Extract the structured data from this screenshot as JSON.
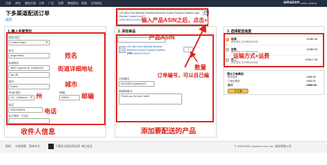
{
  "topbar": {
    "brand": "amazon",
    "brand_sub": "seller central",
    "nav_items": [
      "目录",
      "库存",
      "确定价格",
      "订单",
      "广告",
      "品牌",
      "数据报告",
      "绩效",
      "应用商店"
    ]
  },
  "page": {
    "title": "下多渠道配送订单",
    "back_link": "返回"
  },
  "address_panel": {
    "heading": "1. 输入买家地址",
    "country_label": "国家/地区",
    "country_value": "United States",
    "name_label": "姓名",
    "name_value": "Angel Mala",
    "street_label": "街道地址",
    "street1_value": "4850 Cypress Dr. Apartment",
    "street2_value": "Apt 4B",
    "city_label": "城市",
    "city_value": "Dublin",
    "state_label": "州/省/地区",
    "state_value": "CA - California",
    "zip_label": "邮编",
    "zip_value": "94568",
    "phone_label": "电话",
    "phone_value": "9252155678",
    "email_label": "电子邮件（可选）",
    "email_value": ""
  },
  "product_panel": {
    "search_value": "LED Bed Floor Bedside Wireless Bluetooth Sunset Projector Ambient Light Remote Control Colorful",
    "search_sub": "ASIN: B0XXXXXXXX",
    "heading": "2. 添加商品",
    "sku_field": "",
    "item_title": "LED Bed Floor Bedside Wireless Bluetooth Sunset Projector Ambient Light",
    "item_sub": "ASIN: B0XXXXXXXX",
    "qty_value": "1",
    "order_id_label": "订单编号",
    "order_id_value": "20220824-Qwerty123",
    "comment_label": "装箱单备注",
    "comment_value": "Thank you for your order",
    "add_button": "添加"
  },
  "shipping_panel": {
    "heading": "3. 选择配送速度",
    "options": [
      {
        "name": "标准",
        "detail": "预计送达 2022年8月29日",
        "price": "US$6.98",
        "selected": true
      },
      {
        "name": "加急",
        "detail": "预计送达 2022年8月26日",
        "price": "US$9.63",
        "selected": false
      },
      {
        "name": "优先",
        "detail": "预计送达 2022年8月25日",
        "price": "US$17.98",
        "selected": false
      }
    ],
    "summary_heading": "预计订单费用",
    "summary_rows": [
      {
        "label": "配送费用",
        "value": "US$6.98"
      },
      {
        "label": "订单处理费",
        "value": "US$0.00"
      },
      {
        "label": "总计",
        "value": "US$6.98"
      }
    ],
    "submit_button": "下订单"
  },
  "annotations": {
    "top_hint": "输入产品ASIN之后，点击+",
    "product_asin": "产品ASIN",
    "quantity": "数量",
    "order_id_hint": "订单编号，可以自己编",
    "name": "姓名",
    "street": "街道详细地址",
    "city": "城市",
    "state": "州",
    "zip": "邮编",
    "phone": "电话",
    "recipient_info": "收件人信息",
    "products_to_ship": "添加要配送的产品",
    "shipping_method": "运输方式+运费"
  },
  "footer": {
    "items": [
      "帮助",
      "计划政策",
      "简体中文",
      "下载亚马逊卖家应用",
      "每日会员"
    ],
    "copyright": "© 1999-2022, Amazon.com, Inc. 或其附属公司"
  },
  "colors": {
    "accent_red": "#e0231b",
    "topbar": "#232f3e",
    "link": "#0066c0"
  }
}
